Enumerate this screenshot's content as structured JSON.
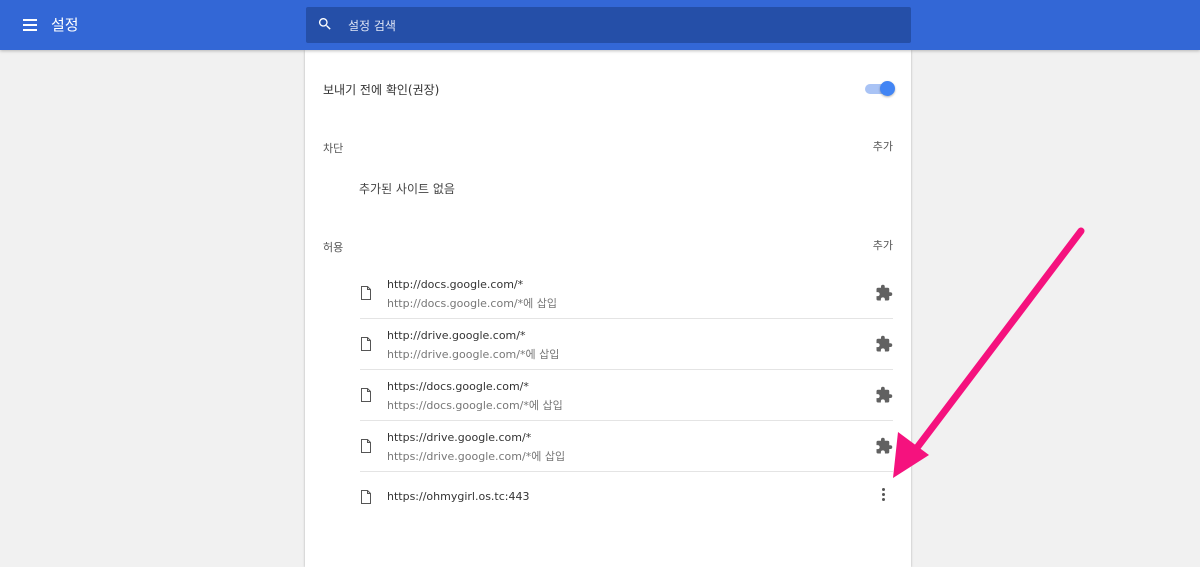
{
  "header": {
    "title": "설정",
    "search_placeholder": "설정 검색"
  },
  "confirm_row": {
    "label": "보내기 전에 확인(권장)",
    "toggle_on": true
  },
  "block_section": {
    "title": "차단",
    "add_label": "추가",
    "empty_text": "추가된 사이트 없음"
  },
  "allow_section": {
    "title": "허용",
    "add_label": "추가",
    "sites": [
      {
        "url": "http://docs.google.com/*",
        "sub": "http://docs.google.com/*에 삽입",
        "action": "extension-icon"
      },
      {
        "url": "http://drive.google.com/*",
        "sub": "http://drive.google.com/*에 삽입",
        "action": "extension-icon"
      },
      {
        "url": "https://docs.google.com/*",
        "sub": "https://docs.google.com/*에 삽입",
        "action": "extension-icon"
      },
      {
        "url": "https://drive.google.com/*",
        "sub": "https://drive.google.com/*에 삽입",
        "action": "extension-icon"
      },
      {
        "url": "https://ohmygirl.os.tc:443",
        "action": "more-vert-icon"
      }
    ]
  },
  "colors": {
    "topbar": "#3367d6",
    "search_bg": "#254fa8",
    "toggle": "#4285f4",
    "annotation_arrow": "#f5127e"
  }
}
